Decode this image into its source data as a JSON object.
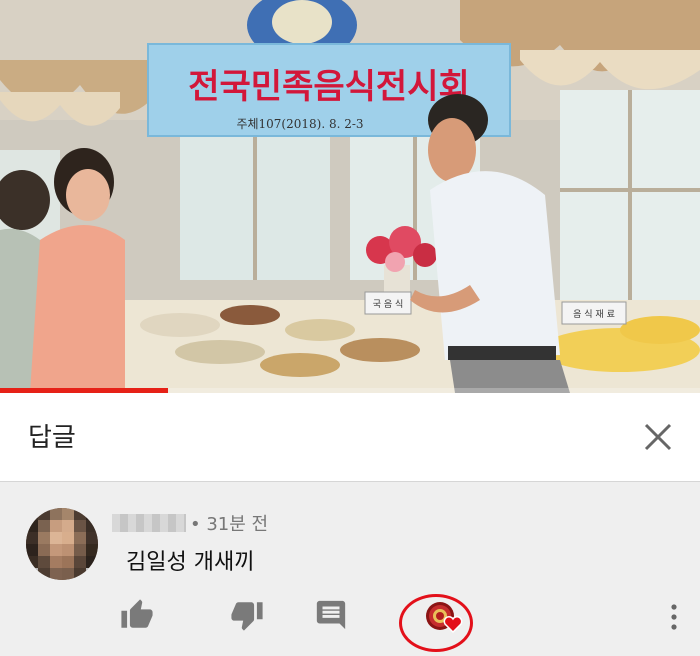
{
  "video": {
    "banner_title": "전국민족음식전시회",
    "banner_subtitle": "주체107(2018). 8. 2-3",
    "sign_left": "국 음 식",
    "sign_right": "음 식 재 료",
    "progress_fraction": 0.24,
    "progress_color": "#e62117"
  },
  "panel": {
    "title": "답글",
    "close_icon": "close-icon"
  },
  "comment": {
    "time": "• 31분 전",
    "text": "김일성 개새끼"
  },
  "actions": {
    "like_icon": "thumbs-up-icon",
    "dislike_icon": "thumbs-down-icon",
    "reply_icon": "comment-icon",
    "creator_heart_icon": "creator-heart-icon",
    "more_icon": "more-vert-icon",
    "highlight_color": "#e3101a"
  }
}
